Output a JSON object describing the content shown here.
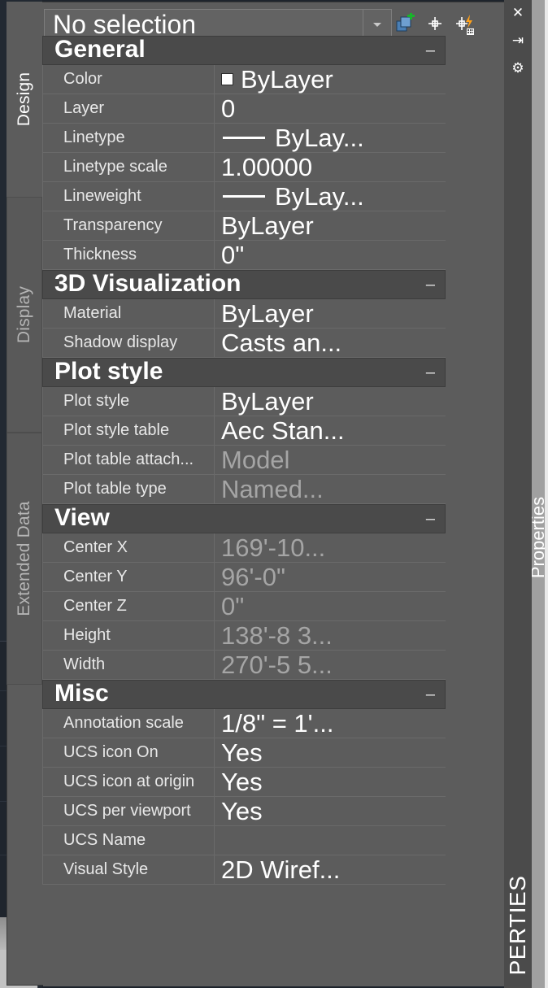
{
  "window": {
    "right_buttons": [
      {
        "name": "close-icon",
        "glyph": "✕"
      },
      {
        "name": "auto-hide-icon",
        "glyph": "⇥"
      },
      {
        "name": "properties-menu-icon",
        "glyph": "⚙"
      }
    ],
    "right_vertical_title": "PERTIES",
    "docked_tab_label": "Properties"
  },
  "sidebar": {
    "tabs": [
      {
        "label": "Design",
        "active": true
      },
      {
        "label": "Display",
        "active": false
      },
      {
        "label": "Extended Data",
        "active": false
      }
    ]
  },
  "toolbar": {
    "selection": {
      "value": "No selection",
      "dropdown_icon": "chevron-down-icon"
    },
    "buttons": [
      {
        "name": "quick-select-button",
        "icon": "quick-select-icon"
      },
      {
        "name": "select-objects-button",
        "icon": "crosshair-icon"
      },
      {
        "name": "quick-calc-button",
        "icon": "quick-calc-icon"
      }
    ]
  },
  "collapse_glyph": "–",
  "sections": [
    {
      "title": "General",
      "rows": [
        {
          "name": "Color",
          "value": "ByLayer",
          "readonly": false,
          "swatch": "#ffffff"
        },
        {
          "name": "Layer",
          "value": "0",
          "readonly": false
        },
        {
          "name": "Linetype",
          "value": "ByLay...",
          "readonly": false,
          "linetype_preview": true
        },
        {
          "name": "Linetype scale",
          "value": "1.00000",
          "readonly": false
        },
        {
          "name": "Lineweight",
          "value": "ByLay...",
          "readonly": false,
          "linetype_preview": true
        },
        {
          "name": "Transparency",
          "value": "ByLayer",
          "readonly": false
        },
        {
          "name": "Thickness",
          "value": "0\"",
          "readonly": false
        }
      ]
    },
    {
      "title": "3D Visualization",
      "rows": [
        {
          "name": "Material",
          "value": "ByLayer",
          "readonly": false
        },
        {
          "name": "Shadow display",
          "value": "Casts an...",
          "readonly": false
        }
      ]
    },
    {
      "title": "Plot style",
      "rows": [
        {
          "name": "Plot style",
          "value": "ByLayer",
          "readonly": false
        },
        {
          "name": "Plot style table",
          "value": "Aec Stan...",
          "readonly": false
        },
        {
          "name": "Plot table attach...",
          "value": "Model",
          "readonly": true
        },
        {
          "name": "Plot table type",
          "value": "Named...",
          "readonly": true
        }
      ]
    },
    {
      "title": "View",
      "rows": [
        {
          "name": "Center X",
          "value": "169'-10...",
          "readonly": true
        },
        {
          "name": "Center Y",
          "value": "96'-0\"",
          "readonly": true
        },
        {
          "name": "Center Z",
          "value": "0\"",
          "readonly": true
        },
        {
          "name": "Height",
          "value": "138'-8 3...",
          "readonly": true
        },
        {
          "name": "Width",
          "value": "270'-5 5...",
          "readonly": true
        }
      ]
    },
    {
      "title": "Misc",
      "rows": [
        {
          "name": "Annotation scale",
          "value": "1/8\" = 1'...",
          "readonly": false
        },
        {
          "name": "UCS icon On",
          "value": "Yes",
          "readonly": false
        },
        {
          "name": "UCS icon at origin",
          "value": "Yes",
          "readonly": false
        },
        {
          "name": "UCS per viewport",
          "value": "Yes",
          "readonly": false
        },
        {
          "name": "UCS Name",
          "value": "",
          "readonly": false
        },
        {
          "name": "Visual Style",
          "value": "2D Wiref...",
          "readonly": false
        }
      ]
    }
  ],
  "colors": {
    "panel_bg": "#5c5c5c",
    "section_header_bg": "#4a4a4a",
    "grid_line": "#6a6a6a",
    "text": "#ffffff",
    "readonly_text": "#a5a5a5",
    "viewport_bg": "#222932",
    "right_bar": "#4b4b4b",
    "gray_strip": "#a0a0a0"
  }
}
